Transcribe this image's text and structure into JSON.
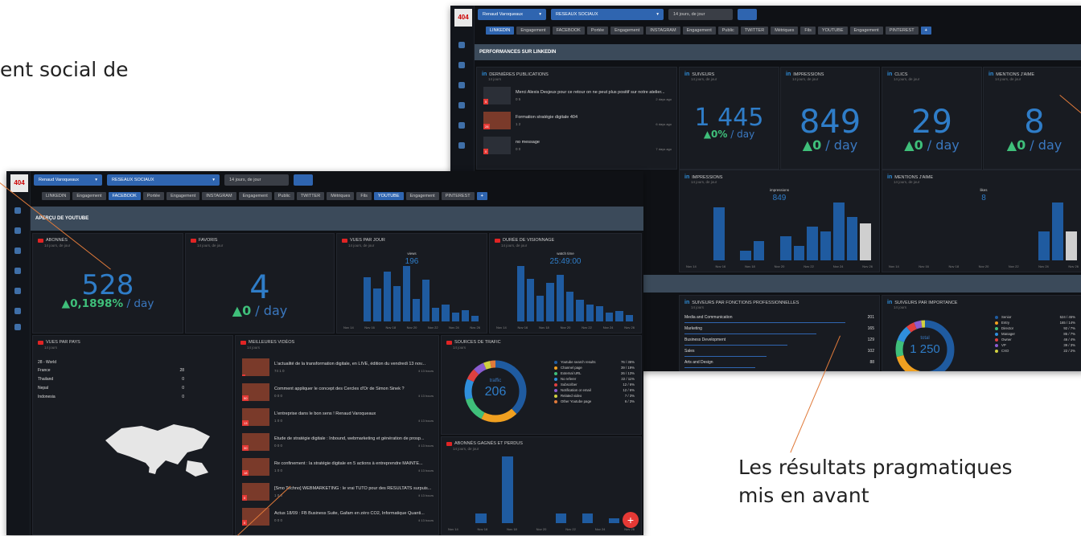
{
  "captions": {
    "top_left": "ent social de",
    "bottom_right_1": "Les résultats pragmatiques",
    "bottom_right_2": "mis en avant"
  },
  "app": {
    "logo": "404",
    "user": "Renaud Varoqueaux",
    "network": "RESEAUX SOCIAUX",
    "period": "14 jours, de jour"
  },
  "linkedin_shot": {
    "tabs": [
      "LINKEDIN",
      "Engagement",
      "FACEBOOK",
      "Portée",
      "Engagement",
      "INSTAGRAM",
      "Engagement",
      "Public",
      "TWITTER",
      "Métriques",
      "Fils",
      "YOUTUBE",
      "Engagement",
      "PINTEREST",
      "+"
    ],
    "banner": "PERFORMANCES SUR LINKEDIN",
    "posts": {
      "title": "DERNIÈRES PUBLICATIONS",
      "sub": "14 jours",
      "items": [
        {
          "text": "Merci Alexis Desjeux pour ce retour on ne peut plus positif sur notre atelier...",
          "meta": "0   5",
          "time": "2 days ago",
          "n": "5"
        },
        {
          "text": "Formation stratégie digitale 404",
          "meta": "1   2",
          "time": "6 days ago",
          "n": "28"
        },
        {
          "text": "no message",
          "meta": "0   0",
          "time": "7 days ago",
          "n": "0"
        }
      ]
    },
    "kpis": [
      {
        "title": "SUIVEURS",
        "sub": "14 jours, de jour",
        "value": "1 445",
        "rate": "▲0%",
        "unit": " / day"
      },
      {
        "title": "IMPRESSIONS",
        "sub": "14 jours, de jour",
        "value": "849",
        "rate": "▲0",
        "unit": " / day"
      },
      {
        "title": "CLICS",
        "sub": "14 jours, de jour",
        "value": "29",
        "rate": "▲0",
        "unit": " / day"
      },
      {
        "title": "MENTIONS J'AIME",
        "sub": "14 jours, de jour",
        "value": "8",
        "rate": "▲0",
        "unit": " / day"
      }
    ],
    "imp_chart": {
      "title": "IMPRESSIONS",
      "sub": "14 jours, de jour",
      "label": "impressions",
      "value": "849",
      "values": [
        0,
        0,
        55,
        0,
        10,
        20,
        0,
        25,
        15,
        35,
        30,
        60,
        45,
        38
      ],
      "x": [
        "Nov 14",
        "Nov 16",
        "Nov 18",
        "Nov 20",
        "Nov 22",
        "Nov 24",
        "Nov 26"
      ]
    },
    "likes_chart": {
      "title": "MENTIONS J'AIME",
      "sub": "14 jours, de jour",
      "label": "likes",
      "value": "8",
      "values": [
        0,
        0,
        0,
        0,
        0,
        0,
        0,
        0,
        0,
        0,
        0,
        1,
        2,
        1
      ],
      "x": [
        "Nov 14",
        "Nov 16",
        "Nov 18",
        "Nov 20",
        "Nov 22",
        "Nov 24",
        "Nov 26"
      ]
    },
    "functions": {
      "title": "SUIVEURS PAR FONCTIONS PROFESSIONNELLES",
      "sub": "14 jours",
      "rows": [
        {
          "label": "Media and Communication",
          "value": "201",
          "pct": 1.0
        },
        {
          "label": "Marketing",
          "value": "165",
          "pct": 0.82
        },
        {
          "label": "Business Development",
          "value": "129",
          "pct": 0.64
        },
        {
          "label": "Sales",
          "value": "102",
          "pct": 0.51
        },
        {
          "label": "Arts and Design",
          "value": "88",
          "pct": 0.44
        }
      ]
    },
    "seniority": {
      "title": "SUIVEURS PAR IMPORTANCE",
      "sub": "14 jours",
      "center_label": "total",
      "center_value": "1 250",
      "legend": [
        {
          "label": "Senior",
          "value": "524 / 45%",
          "color": "#1f5ba0"
        },
        {
          "label": "Entry",
          "value": "165 / 14%",
          "color": "#f0a020"
        },
        {
          "label": "Director",
          "value": "92 / 7%",
          "color": "#3fbf7a"
        },
        {
          "label": "Manager",
          "value": "85 / 7%",
          "color": "#2f8fdc"
        },
        {
          "label": "Owner",
          "value": "46 / 4%",
          "color": "#e04040"
        },
        {
          "label": "VP",
          "value": "39 / 3%",
          "color": "#8a5cd0"
        },
        {
          "label": "CXO",
          "value": "22 / 2%",
          "color": "#d0d040"
        }
      ]
    }
  },
  "youtube_shot": {
    "tabs": [
      "LINKEDIN",
      "Engagement",
      "FACEBOOK",
      "Portée",
      "Engagement",
      "INSTAGRAM",
      "Engagement",
      "Public",
      "TWITTER",
      "Métriques",
      "Fils",
      "YOUTUBE",
      "Engagement",
      "PINTEREST",
      "+"
    ],
    "banner": "APERÇU DE YOUTUBE",
    "kpis": [
      {
        "title": "ABONNÉS",
        "sub": "14 jours, de jour",
        "value": "528",
        "rate": "▲0,1898%",
        "unit": " / day"
      },
      {
        "title": "FAVORIS",
        "sub": "14 jours, de jour",
        "value": "4",
        "rate": "▲0",
        "unit": " / day"
      }
    ],
    "views_chart": {
      "title": "VUES PAR JOUR",
      "sub": "14 jours, de jour",
      "label": "views",
      "value": "196",
      "values": [
        0,
        0,
        40,
        30,
        45,
        32,
        50,
        20,
        38,
        12,
        15,
        8,
        10,
        5
      ],
      "x": [
        "Nov 14",
        "Nov 16",
        "Nov 18",
        "Nov 20",
        "Nov 22",
        "Nov 24",
        "Nov 26"
      ]
    },
    "watch_chart": {
      "title": "DURÉE DE VISIONNAGE",
      "sub": "14 jours, de jour",
      "label": "watch time",
      "value": "25:49:00",
      "values": [
        0,
        0,
        65,
        50,
        30,
        45,
        55,
        35,
        25,
        20,
        18,
        10,
        12,
        8
      ],
      "x": [
        "Nov 14",
        "Nov 16",
        "Nov 18",
        "Nov 20",
        "Nov 22",
        "Nov 24",
        "Nov 26"
      ]
    },
    "countries": {
      "title": "VUES PAR PAYS",
      "sub": "14 jours",
      "header": "28 - World",
      "rows": [
        {
          "label": "France",
          "value": "28"
        },
        {
          "label": "Thailand",
          "value": "0"
        },
        {
          "label": "Nepal",
          "value": "0"
        },
        {
          "label": "Indonesia",
          "value": "0"
        }
      ]
    },
    "videos": {
      "title": "MEILLEURES VIDÉOS",
      "sub": "14 jours",
      "items": [
        {
          "text": "L'actualité de la transformation digitale, en LIVE, édition du vendredi 13 nov...",
          "meta": "74   1   0",
          "time": "il 13 hours",
          "n": ""
        },
        {
          "text": "Comment appliquer le concept des Cercles d'Or de Simon Sinek ?",
          "meta": "0   0   0",
          "time": "il 13 hours",
          "n": "50"
        },
        {
          "text": "L'entreprise dans le bon sens ! Renaud Varoqueaux",
          "meta": "1   0   0",
          "time": "il 13 hours",
          "n": "13"
        },
        {
          "text": "Etude de stratégie digitale : Inbound, webmarketing et génération de prosp...",
          "meta": "0   0   0",
          "time": "il 13 hours",
          "n": "30"
        },
        {
          "text": "Re confinement : la stratégie digitale en 5 actions à entreprendre MAINTE...",
          "meta": "1   0   0",
          "time": "il 13 hours",
          "n": "18"
        },
        {
          "text": "[Smo Techno] WEBMARKETING : le vrai TUTO pour des RÉSULTATS surpuis...",
          "meta": "1   0   0",
          "time": "il 13 hours",
          "n": "0"
        },
        {
          "text": "Actus 18/09 : FB Business Suite, Gafam en zéro CO2, Informatique Quanti...",
          "meta": "0   0   0",
          "time": "il 13 hours",
          "n": "0"
        }
      ]
    },
    "traffic": {
      "title": "SOURCES DE TRAFIC",
      "sub": "14 jours",
      "center_label": "traffic",
      "center_value": "206",
      "legend": [
        {
          "label": "Youtube search results",
          "value": "76 / 36%",
          "color": "#1f5ba0"
        },
        {
          "label": "Channel page",
          "value": "39 / 19%",
          "color": "#f0a020"
        },
        {
          "label": "External URL",
          "value": "26 / 13%",
          "color": "#3fbf7a"
        },
        {
          "label": "No referer",
          "value": "22 / 11%",
          "color": "#2f8fdc"
        },
        {
          "label": "Subscriber",
          "value": "12 / 6%",
          "color": "#e04040"
        },
        {
          "label": "Notification or email",
          "value": "12 / 6%",
          "color": "#8a5cd0"
        },
        {
          "label": "Related video",
          "value": "7 / 3%",
          "color": "#d0d040"
        },
        {
          "label": "Other Youtube page",
          "value": "6 / 3%",
          "color": "#e07a3a"
        }
      ]
    },
    "subs": {
      "title": "ABONNÉS GAGNÉS ET PERDUS",
      "sub": "14 jours, de jour",
      "values": [
        0,
        0,
        8,
        0,
        55,
        0,
        0,
        0,
        8,
        0,
        8,
        0,
        4,
        0
      ],
      "x": [
        "Nov 14",
        "Nov 16",
        "Nov 18",
        "Nov 20",
        "Nov 22",
        "Nov 24",
        "Nov 26"
      ]
    },
    "fab": "+"
  }
}
